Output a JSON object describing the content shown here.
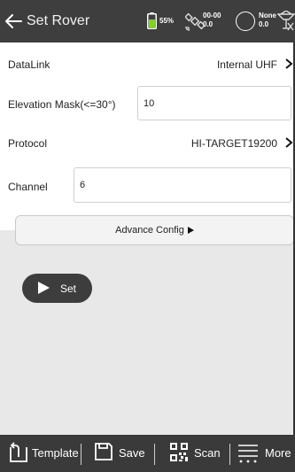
{
  "header": {
    "title": "Set Rover",
    "back_icon": "arrow-left-icon",
    "battery": "55%",
    "sat_line1": "00-00",
    "sat_line2": "0.0",
    "solution_line1": "None",
    "solution_line2": "0.0",
    "battery_color": "#7fd321"
  },
  "form": {
    "datalink_label": "DataLink",
    "datalink_value": "Internal UHF",
    "elevation_label": "Elevation Mask(<=30°)",
    "elevation_value": "10",
    "protocol_label": "Protocol",
    "protocol_value": "HI-TARGET19200",
    "channel_label": "Channel",
    "channel_value": "6",
    "advance_label": "Advance Config"
  },
  "actions": {
    "set_label": "Set"
  },
  "bottom_bar": {
    "template": "Template",
    "save": "Save",
    "scan": "Scan",
    "more": "More"
  }
}
